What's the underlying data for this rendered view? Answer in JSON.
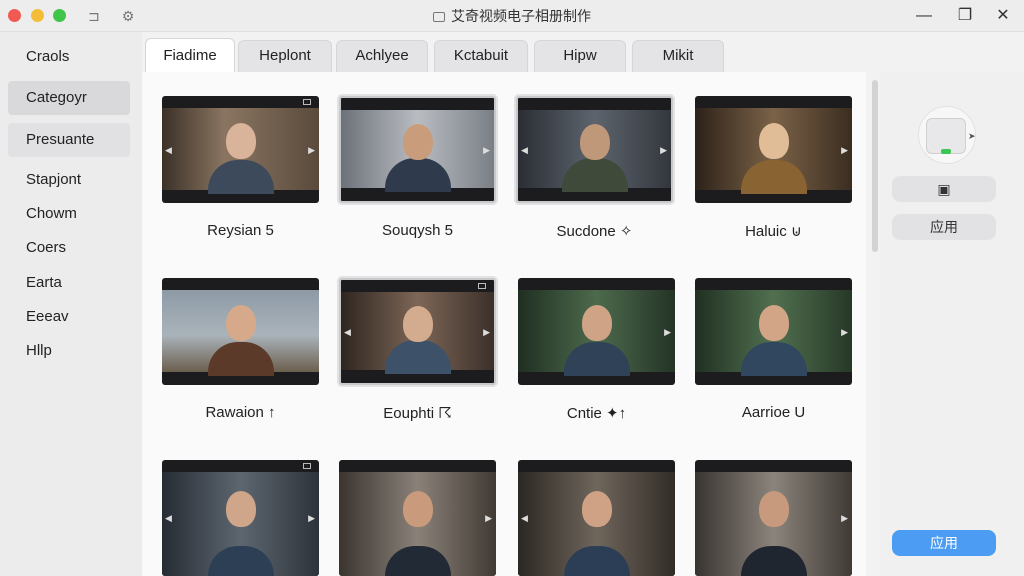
{
  "window": {
    "title": "艾奇视频电子相册制作",
    "close_glyph": "✕",
    "maximize_glyph": "❐"
  },
  "sidebar": {
    "items": [
      {
        "label": "Craols"
      },
      {
        "label": "Categoyr"
      },
      {
        "label": "Presuante"
      },
      {
        "label": "Stapjont"
      },
      {
        "label": "Chowm"
      },
      {
        "label": "Coers"
      },
      {
        "label": "Earta"
      },
      {
        "label": "Eeeav"
      },
      {
        "label": "Hllp"
      }
    ]
  },
  "tabs": [
    {
      "label": "Fiadime"
    },
    {
      "label": "Heplont"
    },
    {
      "label": "Achlyee"
    },
    {
      "label": "Kctabuit"
    },
    {
      "label": "Hipw"
    },
    {
      "label": "Mikit"
    }
  ],
  "grid": {
    "cards": [
      {
        "caption": "Reysian 5"
      },
      {
        "caption": "Souqysh 5"
      },
      {
        "caption": "Sucdone ✧"
      },
      {
        "caption": "Haluic ⊍"
      },
      {
        "caption": "Rawaion ↑"
      },
      {
        "caption": "Eouphti ☈"
      },
      {
        "caption": "Cntie ✦↑"
      },
      {
        "caption": "Aarrioe U"
      },
      {
        "caption": ""
      },
      {
        "caption": ""
      },
      {
        "caption": ""
      },
      {
        "caption": ""
      }
    ]
  },
  "right_panel": {
    "apply_label": "应用",
    "apply_primary_label": "应用"
  },
  "colors": {
    "accent": "#4b9cf2",
    "close_red": "#f05a52",
    "minimize_yellow": "#f4bd38",
    "zoom_green": "#40c54a"
  }
}
